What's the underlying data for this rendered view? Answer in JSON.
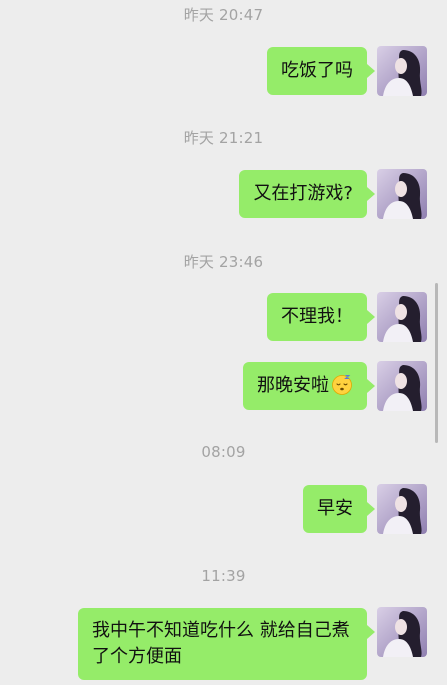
{
  "chat": {
    "timestamps": [
      {
        "id": "ts-1",
        "text": "昨天 20:47"
      },
      {
        "id": "ts-2",
        "text": "昨天 21:21"
      },
      {
        "id": "ts-3",
        "text": "昨天 23:46"
      },
      {
        "id": "ts-4",
        "text": "08:09"
      },
      {
        "id": "ts-5",
        "text": "11:39"
      }
    ],
    "messages": [
      {
        "text": "吃饭了吗"
      },
      {
        "text": "又在打游戏?"
      },
      {
        "text": "不理我！"
      },
      {
        "text": "那晚安啦",
        "emoji": "sleeping-face-icon"
      },
      {
        "text": "早安"
      },
      {
        "text": "我中午不知道吃什么 就给自己煮了个方便面"
      }
    ]
  },
  "colors": {
    "background": "#ededed",
    "bubble": "#95ec69",
    "timestamp": "#a3a3a3",
    "text": "#111111",
    "scrollbar": "#b8b8b8"
  }
}
